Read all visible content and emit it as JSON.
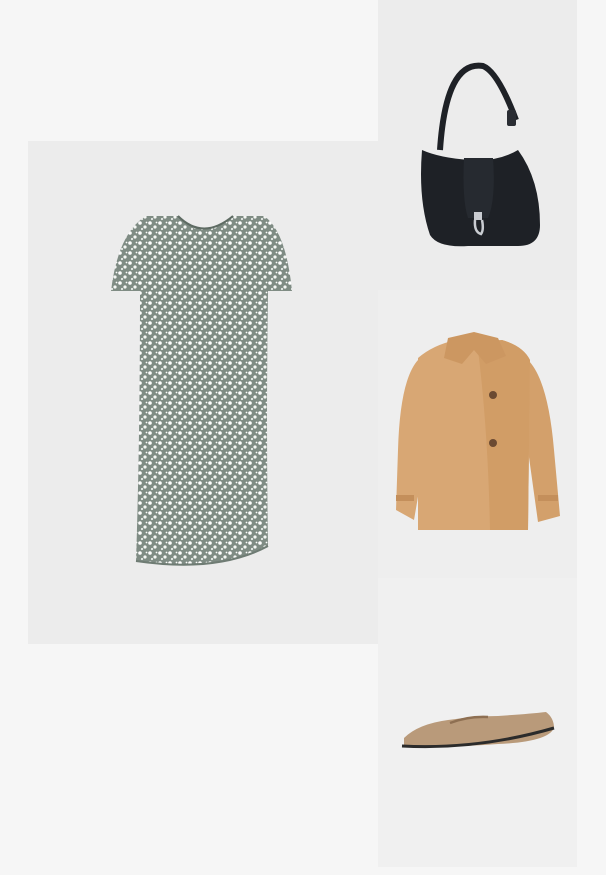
{
  "outfit": {
    "items": [
      {
        "product": "dress",
        "name": "floral-dress"
      },
      {
        "product": "handbag",
        "name": "black-shoulder-bag"
      },
      {
        "product": "jacket",
        "name": "camel-jacket"
      },
      {
        "product": "shoe",
        "name": "suede-boat-shoe"
      }
    ]
  },
  "colors": {
    "page_bg": "#f6f6f6",
    "tile_bg": "#ececec",
    "dress_base": "#8a958e",
    "dress_flower": "#ffffff",
    "bag": "#1e2126",
    "bag_hardware": "#c9ccd1",
    "jacket": "#d8a774",
    "jacket_shadow": "#c48f5b",
    "jacket_button": "#6b4a32",
    "shoe": "#b99a7a",
    "shoe_sole": "#2b2b2b"
  }
}
